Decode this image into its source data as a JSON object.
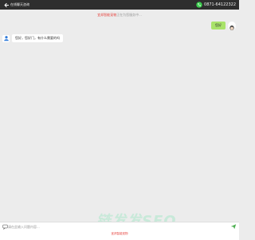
{
  "header": {
    "title": "在线聊天咨询",
    "phone": "0871-64122322"
  },
  "notice": {
    "highlight": "宜邦智能宠物",
    "rest": "正在为您服务中..."
  },
  "messages": [
    {
      "from": "user",
      "text": "您好"
    },
    {
      "from": "agent",
      "text": "您好，您好门，有什么需要的吗"
    }
  ],
  "composer": {
    "placeholder": "请在此输入问题内容..."
  },
  "footer": {
    "brand": "宜邦智能宠物"
  },
  "watermark": {
    "text": "链发发SEO"
  },
  "colors": {
    "header_bg": "#2e2e2e",
    "user_bubble": "#a9e36a",
    "accent_red": "#e6413c",
    "phone_green": "#3ccf4e",
    "send_green": "#4caf50"
  }
}
